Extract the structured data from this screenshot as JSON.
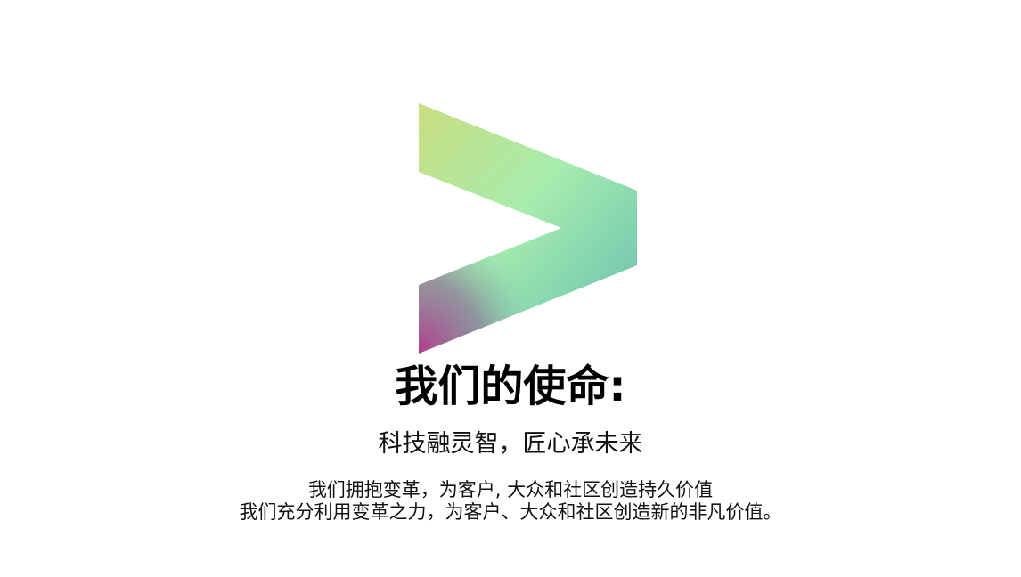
{
  "mission": {
    "heading": "我们的使命:",
    "tagline": "科技融灵智，匠心承未来",
    "lines": [
      "我们拥抱变革，为客户, 大众和社区创造持久价值",
      "我们充分利用变革之力，为客户、大众和社区创造新的非凡价值。"
    ]
  },
  "brand": {
    "logo_icon": "chevron-right-icon",
    "gradient_colors": [
      "#c8e07e",
      "#a8ecb0",
      "#7dcfb4",
      "#b0428a"
    ]
  }
}
